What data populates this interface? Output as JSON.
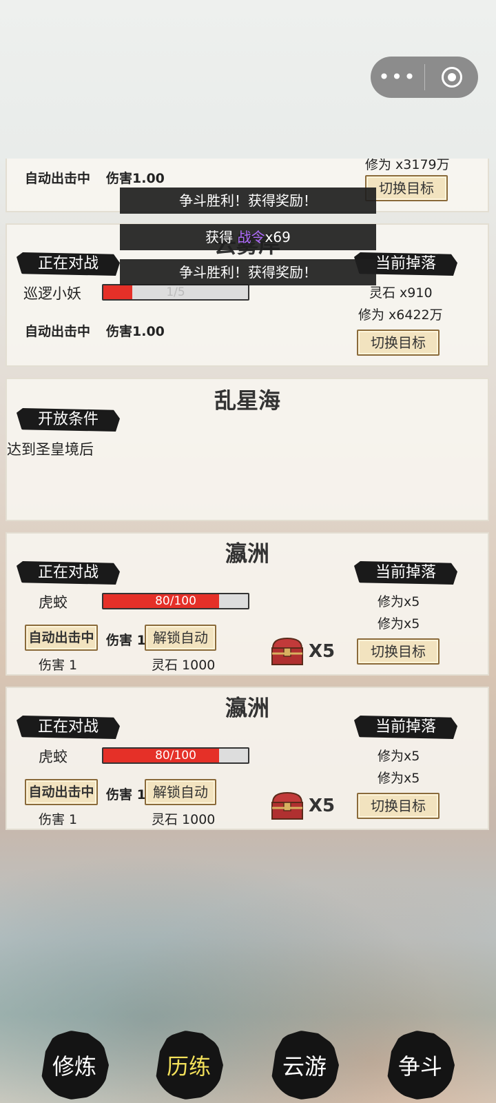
{
  "capsule": {
    "more_icon": "more-dots-icon",
    "close_icon": "target-icon"
  },
  "cards": [
    {
      "auto_label": "自动出击中",
      "damage": "伤害1.00",
      "drop_partial": "修为 x3179万",
      "switch_label": "切换目标"
    },
    {
      "title": "云雾岸",
      "status_tag": "正在对战",
      "drop_tag": "当前掉落",
      "enemy": "巡逻小妖",
      "hp_text": "1/5",
      "hp_fraction": 0.2,
      "drop_items": [
        "灵石 x910",
        "修为 x6422万"
      ],
      "auto_label": "自动出击中",
      "damage": "伤害1.00",
      "switch_label": "切换目标"
    },
    {
      "title": "乱星海",
      "cond_tag": "开放条件",
      "condition": "达到圣皇境后"
    },
    {
      "title": "瀛洲",
      "status_tag": "正在对战",
      "drop_tag": "当前掉落",
      "enemy": "虎蛟",
      "hp_text": "80/100",
      "hp_fraction": 0.8,
      "drop_items": [
        "修为x5",
        "修为x5"
      ],
      "auto_btn": "自动出击中",
      "damage": "伤害 1",
      "unlock_btn": "解锁自动",
      "damage_sub": "伤害 1",
      "cost": "灵石 1000",
      "chest_count": "X5",
      "switch_label": "切换目标"
    },
    {
      "title": "瀛洲",
      "status_tag": "正在对战",
      "drop_tag": "当前掉落",
      "enemy": "虎蛟",
      "hp_text": "80/100",
      "hp_fraction": 0.8,
      "drop_items": [
        "修为x5",
        "修为x5"
      ],
      "auto_btn": "自动出击中",
      "damage": "伤害 1",
      "unlock_btn": "解锁自动",
      "damage_sub": "伤害 1",
      "cost": "灵石 1000",
      "chest_count": "X5",
      "switch_label": "切换目标"
    }
  ],
  "toasts": {
    "t1": "争斗胜利！获得奖励！",
    "t2_prefix": "获得 ",
    "t2_highlight": "战令",
    "t2_suffix": "x69",
    "t3": "争斗胜利！获得奖励！"
  },
  "nav": [
    "修炼",
    "历练",
    "云游",
    "争斗"
  ],
  "nav_active": "历练"
}
